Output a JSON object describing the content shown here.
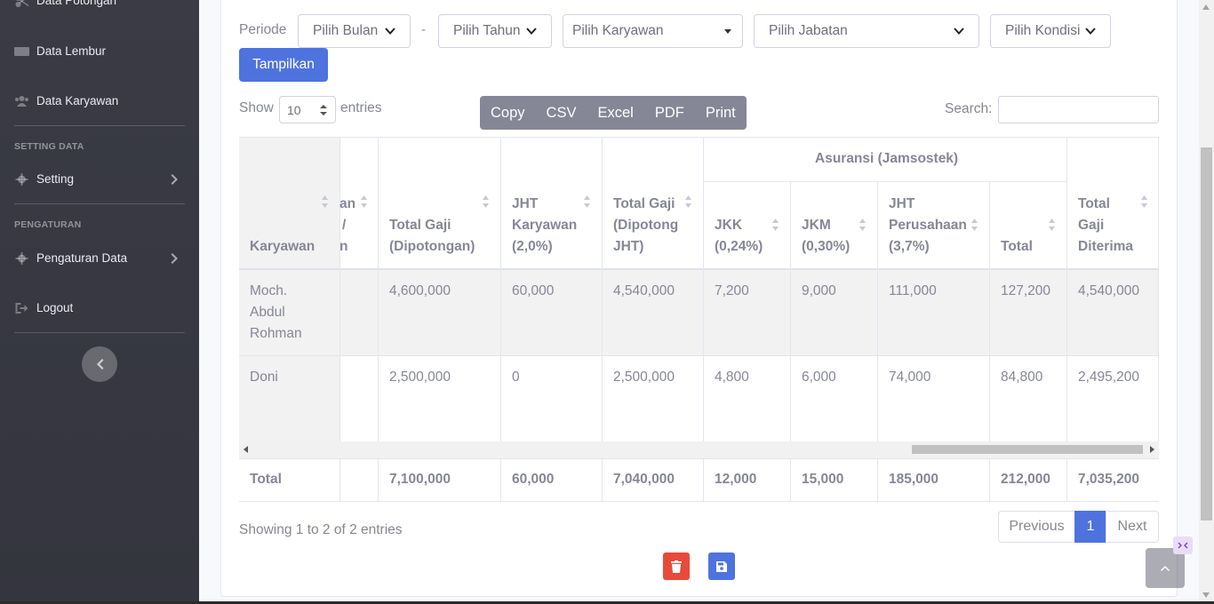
{
  "sidebar": {
    "items": [
      {
        "label": "Data Potongan",
        "icon": "cut-icon"
      },
      {
        "label": "Data Lembur",
        "icon": "money-icon"
      },
      {
        "label": "Data Karyawan",
        "icon": "users-icon"
      }
    ],
    "heading_setting": "SETTING DATA",
    "setting_label": "Setting",
    "heading_pengaturan": "PENGATURAN",
    "pengaturan_label": "Pengaturan Data",
    "logout_label": "Logout"
  },
  "filters": {
    "periode_label": "Periode",
    "bulan": "Pilih Bulan",
    "separator": "-",
    "tahun": "Pilih Tahun",
    "karyawan": "Pilih Karyawan",
    "jabatan": "Pilih Jabatan",
    "kondisi": "Pilih Kondisi",
    "submit": "Tampilkan"
  },
  "table_controls": {
    "show": "Show",
    "entries_value": "10",
    "entries": "entries",
    "buttons": [
      "Copy",
      "CSV",
      "Excel",
      "PDF",
      "Print"
    ],
    "search_label": "Search:"
  },
  "table": {
    "group_header": "Asuransi (Jamsostek)",
    "headers": {
      "karyawan": "Karyawan",
      "partial_1": "an",
      "partial_2": "/",
      "partial_3": "n",
      "total_gaji_pot_1": "Total Gaji",
      "total_gaji_pot_2": "(Dipotongan)",
      "jht_kar_1": "JHT",
      "jht_kar_2": "Karyawan",
      "jht_kar_3": "(2,0%)",
      "total_jht_1": "Total Gaji",
      "total_jht_2": "(Dipotong",
      "total_jht_3": "JHT)",
      "jkk_1": "JKK",
      "jkk_2": "(0,24%)",
      "jkm_1": "JKM",
      "jkm_2": "(0,30%)",
      "jhtp_1": "JHT",
      "jhtp_2": "Perusahaan",
      "jhtp_3": "(3,7%)",
      "total": "Total",
      "diterima_1": "Total",
      "diterima_2": "Gaji",
      "diterima_3": "Diterima"
    },
    "rows": [
      {
        "name_1": "Moch.",
        "name_2": "Abdul",
        "name_3": "Rohman",
        "total_gaji_pot": "4,600,000",
        "jht_kar": "60,000",
        "total_jht": "4,540,000",
        "jkk": "7,200",
        "jkm": "9,000",
        "jhtp": "111,000",
        "total": "127,200",
        "diterima": "4,540,000"
      },
      {
        "name_1": "Doni",
        "total_gaji_pot": "2,500,000",
        "jht_kar": "0",
        "total_jht": "2,500,000",
        "jkk": "4,800",
        "jkm": "6,000",
        "jhtp": "74,000",
        "total": "84,800",
        "diterima": "2,495,200"
      }
    ],
    "footer": {
      "label": "Total",
      "total_gaji_pot": "7,100,000",
      "jht_kar": "60,000",
      "total_jht": "7,040,000",
      "jkk": "12,000",
      "jkm": "15,000",
      "jhtp": "185,000",
      "total": "212,000",
      "diterima": "7,035,200"
    }
  },
  "pagination": {
    "info": "Showing 1 to 2 of 2 entries",
    "previous": "Previous",
    "page": "1",
    "next": "Next"
  },
  "colors": {
    "primary": "#4e73df",
    "danger": "#e74a3b",
    "sidebar": "#3a3b45"
  }
}
